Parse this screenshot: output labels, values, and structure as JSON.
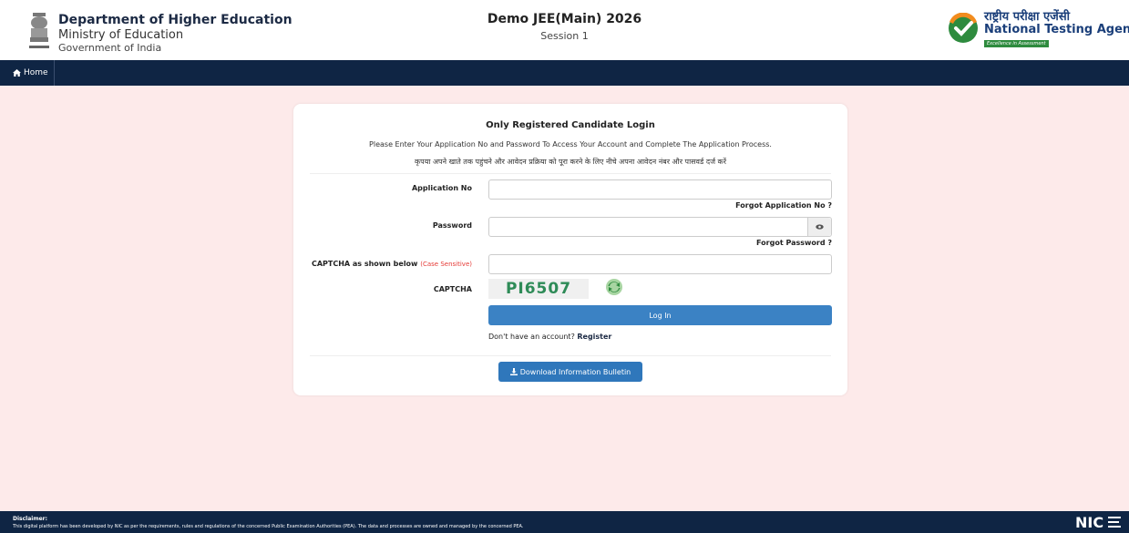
{
  "header": {
    "dept_name": "Department of Higher Education",
    "ministry": "Ministry of Education",
    "government": "Government of India",
    "exam_title": "Demo JEE(Main) 2026",
    "session": "Session 1",
    "agency_hindi": "राष्ट्रीय परीक्षा एजेंसी",
    "agency_english": "National Testing Agency",
    "agency_tagline": "Excellence in Assessment"
  },
  "nav": {
    "home_label": "Home",
    "home_icon": "home-icon"
  },
  "login": {
    "title": "Only Registered Candidate Login",
    "instruction_en": "Please Enter Your Application No and Password To Access Your Account and Complete The Application Process.",
    "instruction_hi": "कृपया अपने खाते तक पहुंचने और आवेदन प्रक्रिया को पूरा करने के लिए नीचे अपना आवेदन नंबर और पासवर्ड दर्ज करें",
    "application_no_label": "Application No",
    "application_no_value": "",
    "forgot_application": "Forgot Application No ?",
    "password_label": "Password",
    "password_value": "",
    "password_toggle_icon": "eye-icon",
    "forgot_password": "Forgot Password ?",
    "captcha_input_label": "CAPTCHA as shown below",
    "case_sensitive": "(Case Sensitive)",
    "captcha_input_value": "",
    "captcha_label": "CAPTCHA",
    "captcha_text": "PI6507",
    "refresh_icon": "refresh-icon",
    "login_button": "Log In",
    "no_account_text": "Don't have an account?",
    "register_link": "Register",
    "download_button": "Download Information Bulletin",
    "download_icon": "download-icon"
  },
  "footer": {
    "disclaimer_title": "Disclaimer:",
    "disclaimer_text": "This digital platform has been developed by NIC as per the requirements, rules and regulations of the concerned Public Examination Authorities (PEA). The data and processes are owned and managed by the concerned PEA.",
    "nic_logo_text": "NIC"
  },
  "colors": {
    "navy": "#0f2544",
    "page_bg": "#fdeaea",
    "primary_button": "#3b82c4",
    "case_sensitive_red": "#e53935",
    "captcha_green": "#2e8b57"
  }
}
